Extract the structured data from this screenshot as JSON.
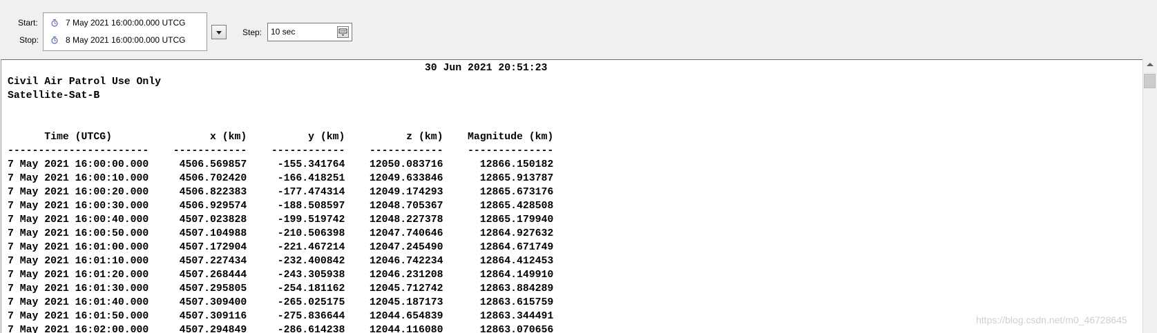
{
  "toolbar": {
    "start_label": "Start:",
    "stop_label": "Stop:",
    "start_value": "7 May 2021 16:00:00.000 UTCG",
    "stop_value": "8 May 2021 16:00:00.000 UTCG",
    "step_label": "Step:",
    "step_value": "10 sec"
  },
  "report": {
    "timestamp": "30 Jun 2021 20:51:23",
    "line1": "Civil Air Patrol Use Only",
    "line2": "Satellite-Sat-B",
    "columns": [
      "Time (UTCG)",
      "x (km)",
      "y (km)",
      "z (km)",
      "Magnitude (km)"
    ],
    "rows": [
      [
        "7 May 2021 16:00:00.000",
        "4506.569857",
        "-155.341764",
        "12050.083716",
        "12866.150182"
      ],
      [
        "7 May 2021 16:00:10.000",
        "4506.702420",
        "-166.418251",
        "12049.633846",
        "12865.913787"
      ],
      [
        "7 May 2021 16:00:20.000",
        "4506.822383",
        "-177.474314",
        "12049.174293",
        "12865.673176"
      ],
      [
        "7 May 2021 16:00:30.000",
        "4506.929574",
        "-188.508597",
        "12048.705367",
        "12865.428508"
      ],
      [
        "7 May 2021 16:00:40.000",
        "4507.023828",
        "-199.519742",
        "12048.227378",
        "12865.179940"
      ],
      [
        "7 May 2021 16:00:50.000",
        "4507.104988",
        "-210.506398",
        "12047.740646",
        "12864.927632"
      ],
      [
        "7 May 2021 16:01:00.000",
        "4507.172904",
        "-221.467214",
        "12047.245490",
        "12864.671749"
      ],
      [
        "7 May 2021 16:01:10.000",
        "4507.227434",
        "-232.400842",
        "12046.742234",
        "12864.412453"
      ],
      [
        "7 May 2021 16:01:20.000",
        "4507.268444",
        "-243.305938",
        "12046.231208",
        "12864.149910"
      ],
      [
        "7 May 2021 16:01:30.000",
        "4507.295805",
        "-254.181162",
        "12045.712742",
        "12863.884289"
      ],
      [
        "7 May 2021 16:01:40.000",
        "4507.309400",
        "-265.025175",
        "12045.187173",
        "12863.615759"
      ],
      [
        "7 May 2021 16:01:50.000",
        "4507.309116",
        "-275.836644",
        "12044.654839",
        "12863.344491"
      ],
      [
        "7 May 2021 16:02:00.000",
        "4507.294849",
        "-286.614238",
        "12044.116080",
        "12863.070656"
      ]
    ]
  },
  "watermark": "https://blog.csdn.net/m0_46728645"
}
